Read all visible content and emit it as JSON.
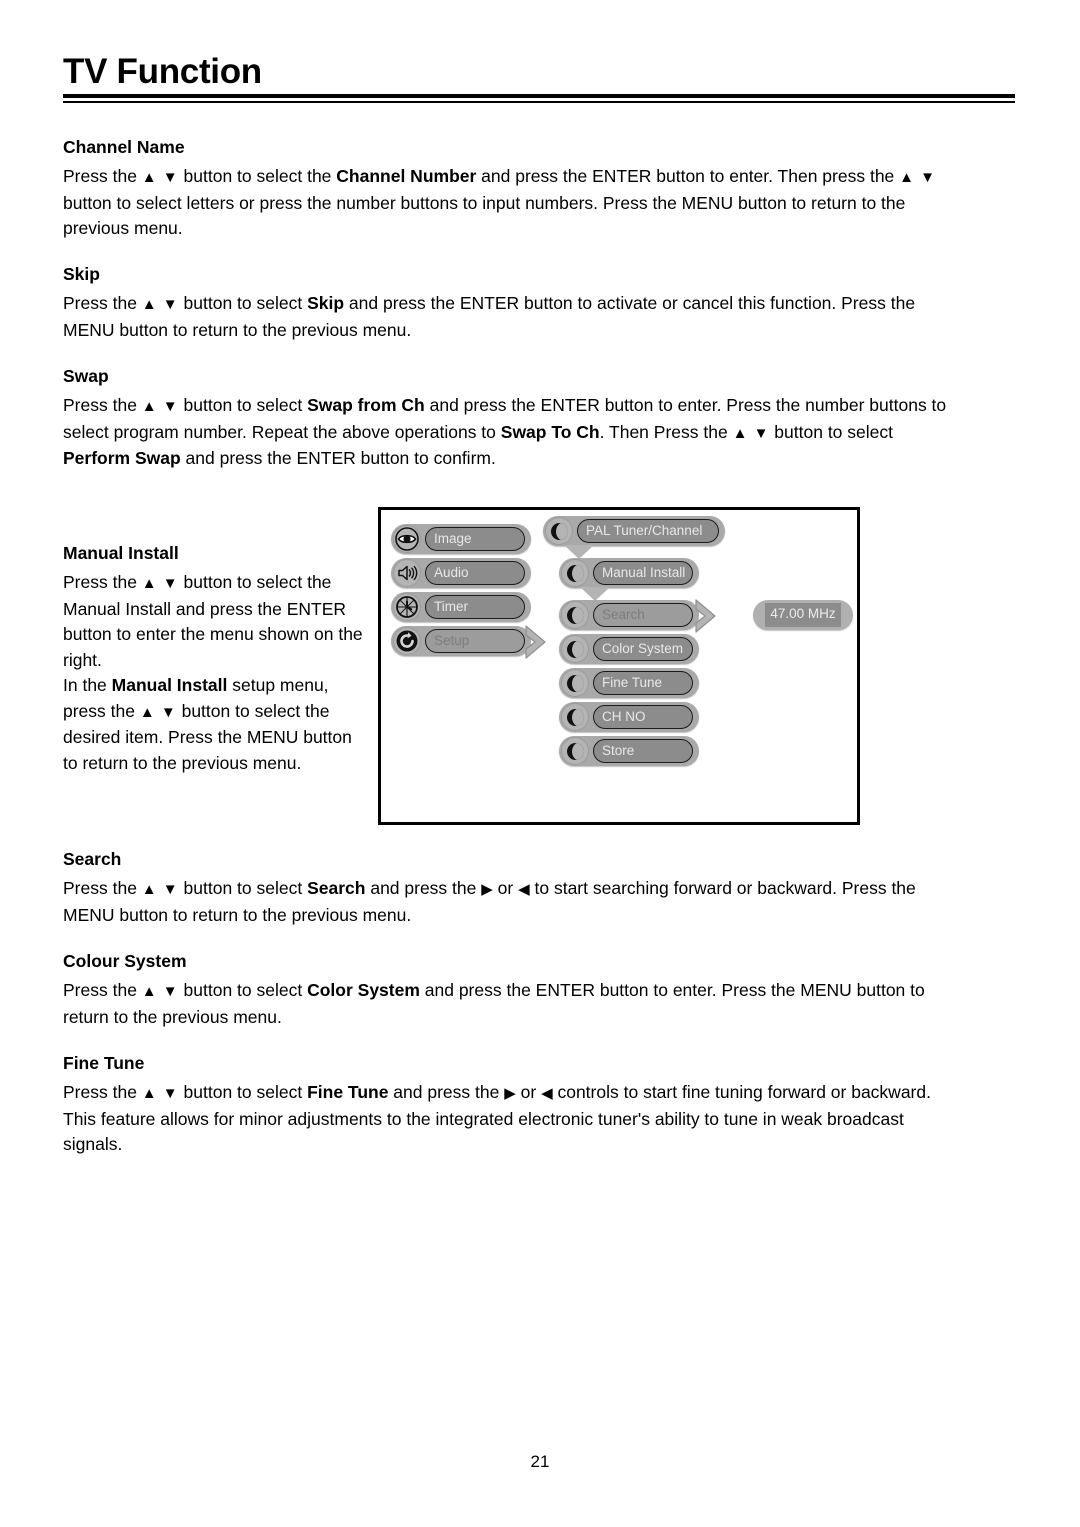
{
  "document": {
    "title": "TV Function",
    "page_number": "21"
  },
  "sections": [
    {
      "id": "channel-name",
      "heading": "Channel Name",
      "paragraphs": [
        [
          {
            "t": "Press the "
          },
          {
            "t": "▲ ▼",
            "style": "arrows"
          },
          {
            "t": " button to select the "
          },
          {
            "t": "Channel Number",
            "style": "bold"
          },
          {
            "t": " and press the ENTER button to enter. Then press the "
          },
          {
            "t": "▲ ▼",
            "style": "arrows"
          },
          {
            "t": " button to select letters or press the number buttons to input numbers. Press the MENU button to return to the previous menu."
          }
        ]
      ]
    },
    {
      "id": "skip",
      "heading": "Skip",
      "paragraphs": [
        [
          {
            "t": "Press the "
          },
          {
            "t": "▲ ▼",
            "style": "arrows"
          },
          {
            "t": " button to select "
          },
          {
            "t": "Skip",
            "style": "bold"
          },
          {
            "t": " and press the ENTER button to activate or cancel this function. Press the MENU button to return to the previous menu."
          }
        ]
      ]
    },
    {
      "id": "swap",
      "heading": "Swap",
      "paragraphs": [
        [
          {
            "t": "Press the "
          },
          {
            "t": "▲ ▼",
            "style": "arrows"
          },
          {
            "t": " button to select "
          },
          {
            "t": "Swap from Ch",
            "style": "bold"
          },
          {
            "t": " and press the ENTER button to enter. Press the number buttons to select program number. Repeat the above operations to "
          },
          {
            "t": "Swap To Ch",
            "style": "bold"
          },
          {
            "t": ". Then Press the "
          },
          {
            "t": "▲ ▼",
            "style": "arrows"
          },
          {
            "t": " button to select "
          },
          {
            "t": "Perform Swap",
            "style": "bold"
          },
          {
            "t": " and press the ENTER button to confirm."
          }
        ]
      ]
    },
    {
      "id": "manual-install",
      "heading": "Manual Install",
      "paragraphs": [
        [
          {
            "t": "Press the "
          },
          {
            "t": "▲ ▼",
            "style": "arrows"
          },
          {
            "t": " button to select the Manual Install and press the ENTER button to enter the menu shown on the right."
          }
        ],
        [
          {
            "t": "In the "
          },
          {
            "t": "Manual Install",
            "style": "bold"
          },
          {
            "t": " setup menu, press the "
          },
          {
            "t": "▲ ▼",
            "style": "arrows"
          },
          {
            "t": " button to select the desired item. Press the MENU button to return to the previous menu."
          }
        ]
      ]
    },
    {
      "id": "search",
      "heading": "Search",
      "paragraphs": [
        [
          {
            "t": "Press the "
          },
          {
            "t": "▲ ▼",
            "style": "arrows"
          },
          {
            "t": " button to select "
          },
          {
            "t": "Search",
            "style": "bold"
          },
          {
            "t": " and press the "
          },
          {
            "t": "▶",
            "style": "tri"
          },
          {
            "t": " or "
          },
          {
            "t": "◀",
            "style": "tri"
          },
          {
            "t": " to start searching forward or backward. Press the MENU button to return to the previous menu."
          }
        ]
      ]
    },
    {
      "id": "colour-system",
      "heading": "Colour System",
      "paragraphs": [
        [
          {
            "t": "Press the "
          },
          {
            "t": "▲ ▼",
            "style": "arrows"
          },
          {
            "t": " button to select "
          },
          {
            "t": "Color System",
            "style": "bold"
          },
          {
            "t": " and press the ENTER button to enter. Press the MENU button to return to the previous menu."
          }
        ]
      ]
    },
    {
      "id": "fine-tune",
      "heading": "Fine Tune",
      "paragraphs": [
        [
          {
            "t": "Press the "
          },
          {
            "t": "▲ ▼",
            "style": "arrows"
          },
          {
            "t": " button to select "
          },
          {
            "t": "Fine Tune",
            "style": "bold"
          },
          {
            "t": " and press  the "
          },
          {
            "t": "▶",
            "style": "tri"
          },
          {
            "t": " or "
          },
          {
            "t": "◀",
            "style": "tri"
          },
          {
            "t": " controls to start fine tuning forward or backward."
          }
        ],
        [
          {
            "t": "This feature allows for minor adjustments to the integrated electronic tuner's ability to tune in weak broadcast signals."
          }
        ]
      ]
    }
  ],
  "osd_diagram": {
    "main_menu": [
      {
        "label": "Image",
        "icon": "eye-icon",
        "selected": false
      },
      {
        "label": "Audio",
        "icon": "speaker-icon",
        "selected": false
      },
      {
        "label": "Timer",
        "icon": "clock-icon",
        "selected": false
      },
      {
        "label": "Setup",
        "icon": "refresh-icon",
        "selected": true
      }
    ],
    "submenu_header": {
      "label": "PAL Tuner/Channel",
      "icon": "crescent-icon"
    },
    "submenu_parent": {
      "label": "Manual Install",
      "icon": "crescent-icon"
    },
    "submenu_items": [
      {
        "label": "Search",
        "icon": "crescent-icon",
        "selected": true
      },
      {
        "label": "Color System",
        "icon": "crescent-icon",
        "selected": false
      },
      {
        "label": "Fine Tune",
        "icon": "crescent-icon",
        "selected": false
      },
      {
        "label": "CH NO",
        "icon": "crescent-icon",
        "selected": false
      },
      {
        "label": "Store",
        "icon": "crescent-icon",
        "selected": false
      }
    ],
    "value_readout": {
      "label": "47.00 MHz"
    }
  }
}
